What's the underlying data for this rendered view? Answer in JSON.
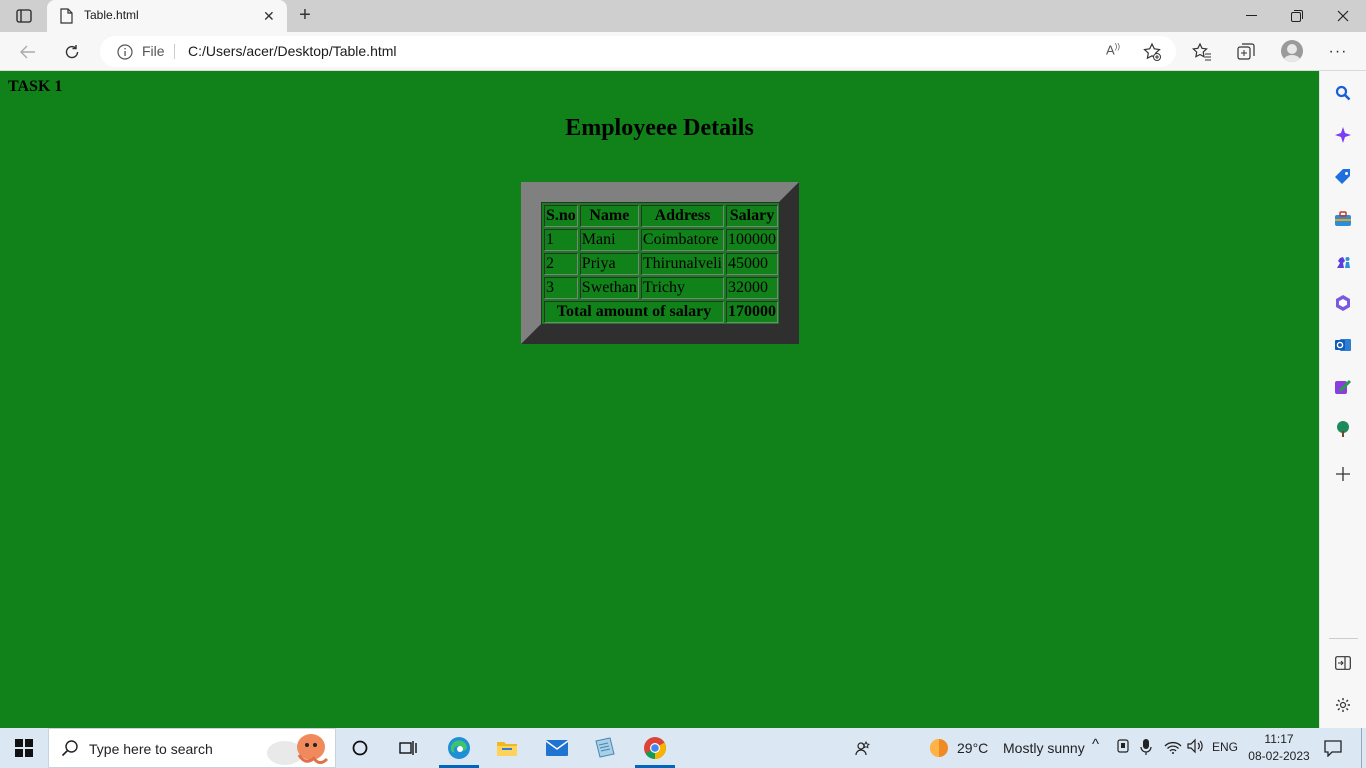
{
  "browser": {
    "tab_title": "Table.html",
    "url_scheme_label": "File",
    "url": "C:/Users/acer/Desktop/Table.html"
  },
  "page": {
    "task_label": "TASK 1",
    "heading": "Employeee Details",
    "background_color": "#118219",
    "table": {
      "headers": [
        "S.no",
        "Name",
        "Address",
        "Salary"
      ],
      "rows": [
        [
          "1",
          "Mani",
          "Coimbatore",
          "100000"
        ],
        [
          "2",
          "Priya",
          "Thirunalveli",
          "45000"
        ],
        [
          "3",
          "Swethan",
          "Trichy",
          "32000"
        ]
      ],
      "total_label": "Total amount of salary",
      "total_value": "170000"
    }
  },
  "taskbar": {
    "search_placeholder": "Type here to search",
    "weather_temp": "29°C",
    "weather_condition": "Mostly sunny",
    "language": "ENG",
    "time": "11:17",
    "date": "08-02-2023"
  }
}
